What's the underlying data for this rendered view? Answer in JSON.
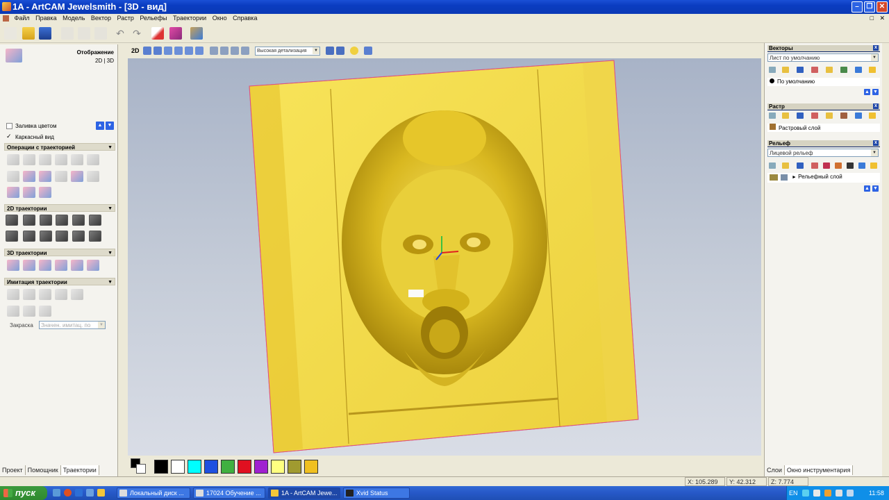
{
  "window": {
    "title": "1A - ArtCAM Jewelsmith - [3D - вид]"
  },
  "menu": [
    "Файл",
    "Правка",
    "Модель",
    "Вектор",
    "Растр",
    "Рельефы",
    "Траектории",
    "Окно",
    "Справка"
  ],
  "left_panel": {
    "display_label": "Отображение",
    "display_mode": "2D | 3D",
    "color_fill_label": "Заливка цветом",
    "wireframe_label": "Каркасный вид",
    "sections": {
      "toolpath_ops": "Операции с траекторией",
      "toolpaths_2d": "2D траектории",
      "toolpaths_3d": "3D траектории",
      "simulation": "Имитация траектории"
    },
    "shading_label": "Закраска",
    "shading_value": "Значен. имитац. по",
    "tabs": [
      "Проект",
      "Помощник",
      "Траектории"
    ]
  },
  "view_toolbar": {
    "mode_2d": "2D",
    "detail_value": "Высокая детализация"
  },
  "palette": {
    "colors": [
      "#000000",
      "#ffffff",
      "#00ffff",
      "#1e50e0",
      "#40b040",
      "#e01020",
      "#a020d0",
      "#ffff80",
      "#a09a30",
      "#f0c020"
    ]
  },
  "right_panel": {
    "vectors": {
      "title": "Векторы",
      "sheet": "Лист по умолчанию",
      "layer": "По умолчанию"
    },
    "raster": {
      "title": "Растр",
      "layer": "Растровый слой"
    },
    "relief": {
      "title": "Рельеф",
      "selector": "Лицевой рельеф",
      "layer": "Рельефный слой"
    },
    "tabs": [
      "Слои",
      "Окно инструментария"
    ]
  },
  "status": {
    "x": "X: 105.289",
    "y": "Y: 42.312",
    "z": "Z: 7.774"
  },
  "taskbar": {
    "start": "пуск",
    "tasks": [
      "Локальный диск ...",
      "17024 Обучение ...",
      "1A - ArtCAM Jewe...",
      "Xvid Status"
    ],
    "lang": "EN",
    "clock": "11:58"
  },
  "colors": {
    "accent": "#0a3cc0",
    "panel_gold": "#f2d23c",
    "viewport_bg": "#b7c0d1"
  }
}
